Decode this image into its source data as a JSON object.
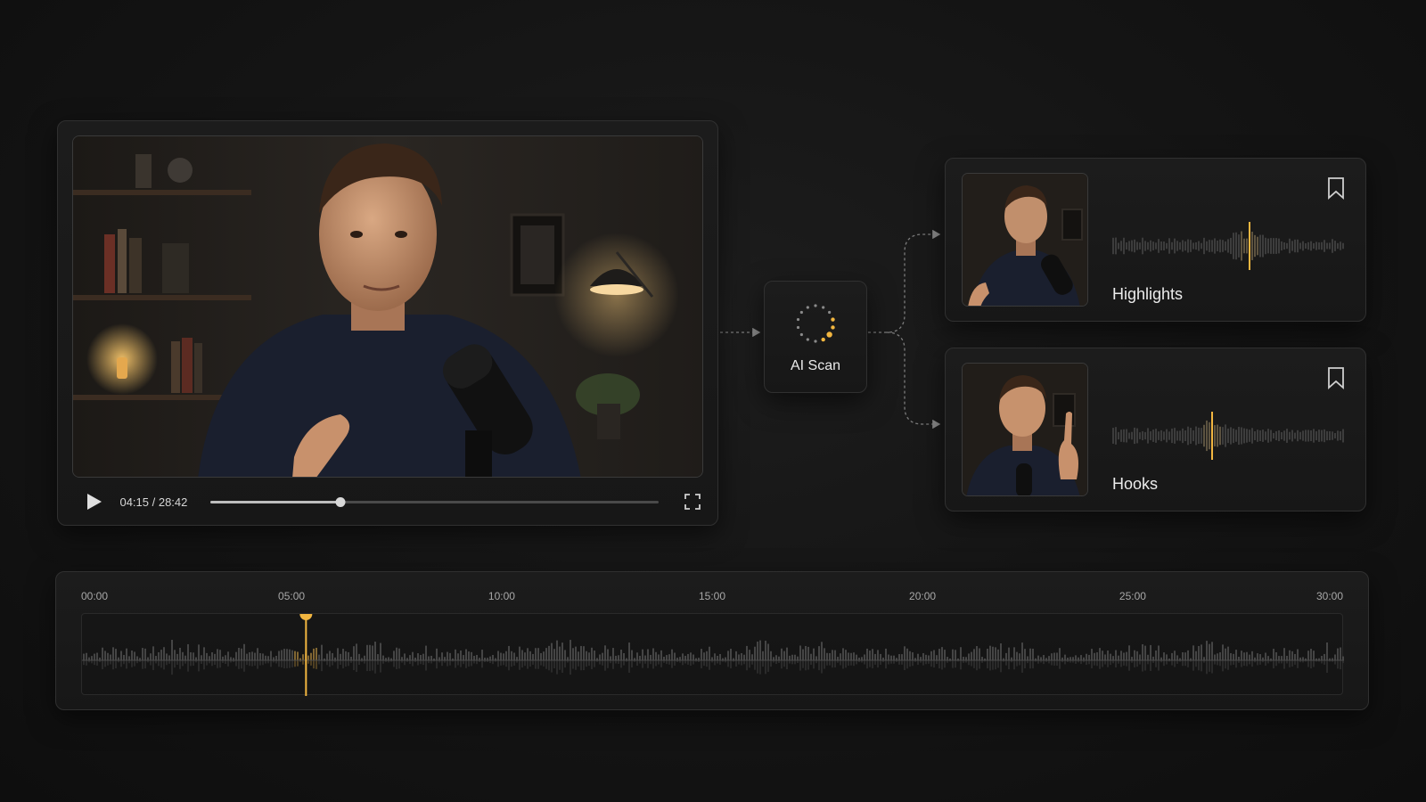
{
  "player": {
    "time_display": "04:15 / 28:42",
    "progress_fraction": 0.29,
    "play_icon": "play-icon",
    "fullscreen_icon": "fullscreen-icon"
  },
  "ai_scan": {
    "label": "AI Scan",
    "icon": "loading-spinner-icon"
  },
  "results": [
    {
      "title": "Highlights",
      "icon": "bookmark-icon"
    },
    {
      "title": "Hooks",
      "icon": "bookmark-icon"
    }
  ],
  "timeline": {
    "ticks": [
      "00:00",
      "05:00",
      "10:00",
      "15:00",
      "20:00",
      "25:00",
      "30:00"
    ],
    "playhead_fraction": 0.1775
  },
  "colors": {
    "accent": "#f2b640",
    "background": "#141414",
    "panel": "#1a1a1a",
    "waveform": "#5a5a5a"
  }
}
